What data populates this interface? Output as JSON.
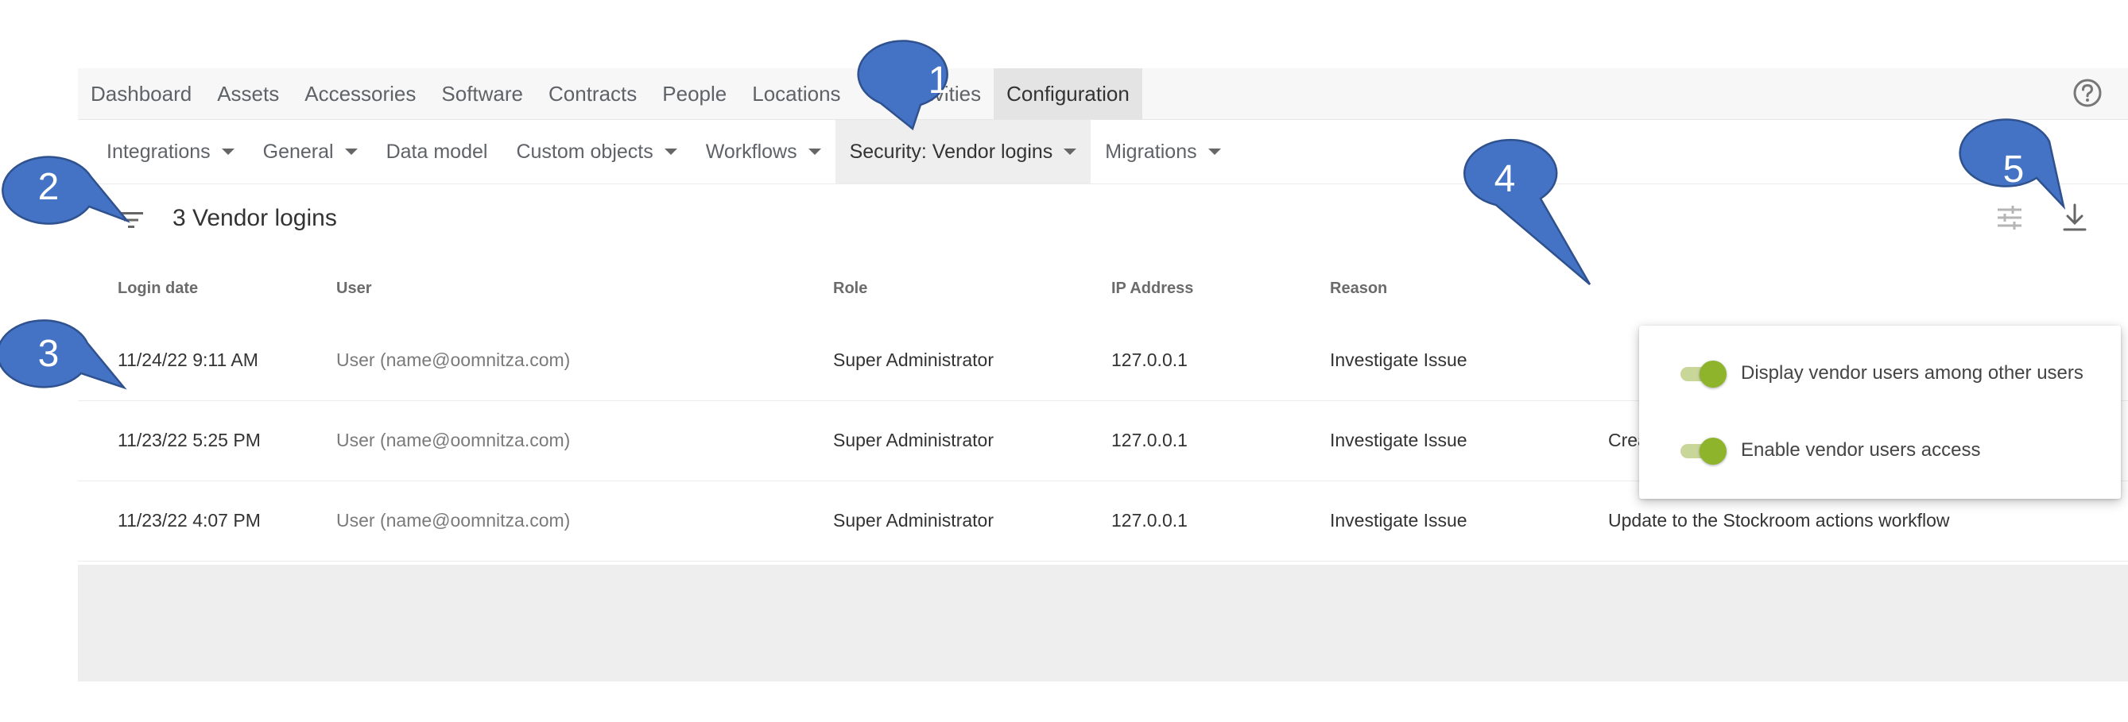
{
  "topnav": {
    "items": [
      "Dashboard",
      "Assets",
      "Accessories",
      "Software",
      "Contracts",
      "People",
      "Locations",
      "Activities",
      "Configuration"
    ],
    "active_index": 8,
    "help_icon": "help-circle-icon"
  },
  "subnav": {
    "items": [
      "Integrations",
      "General",
      "Data model",
      "Custom objects",
      "Workflows",
      "Security: Vendor logins",
      "Migrations"
    ],
    "has_caret": [
      true,
      true,
      false,
      true,
      true,
      true,
      true
    ],
    "active_index": 5
  },
  "toolbar": {
    "title": "3 Vendor logins",
    "filter_icon": "filter-icon",
    "tune_icon": "tune-icon",
    "download_icon": "download-icon"
  },
  "table": {
    "columns": [
      "Login date",
      "User",
      "Role",
      "IP Address",
      "Reason",
      ""
    ],
    "rows": [
      {
        "login_date": "11/24/22 9:11 AM",
        "user": "User (name@oomnitza.com)",
        "role": "Super Administrator",
        "ip": "127.0.0.1",
        "reason": "Investigate Issue",
        "note": ""
      },
      {
        "login_date": "11/23/22 5:25 PM",
        "user": "User (name@oomnitza.com)",
        "role": "Super Administrator",
        "ip": "127.0.0.1",
        "reason": "Investigate Issue",
        "note": "Creating new role"
      },
      {
        "login_date": "11/23/22 4:07 PM",
        "user": "User (name@oomnitza.com)",
        "role": "Super Administrator",
        "ip": "127.0.0.1",
        "reason": "Investigate Issue",
        "note": "Update to the Stockroom actions workflow"
      }
    ]
  },
  "settings_menu": {
    "toggles": [
      {
        "label": "Display vendor users among other users",
        "on": true
      },
      {
        "label": "Enable vendor users access",
        "on": true
      }
    ],
    "accent_color": "#8db42b"
  },
  "callouts": [
    "1",
    "2",
    "3",
    "4",
    "5"
  ],
  "colors": {
    "callout_fill": "#4472c4",
    "callout_stroke": "#2f528f"
  }
}
